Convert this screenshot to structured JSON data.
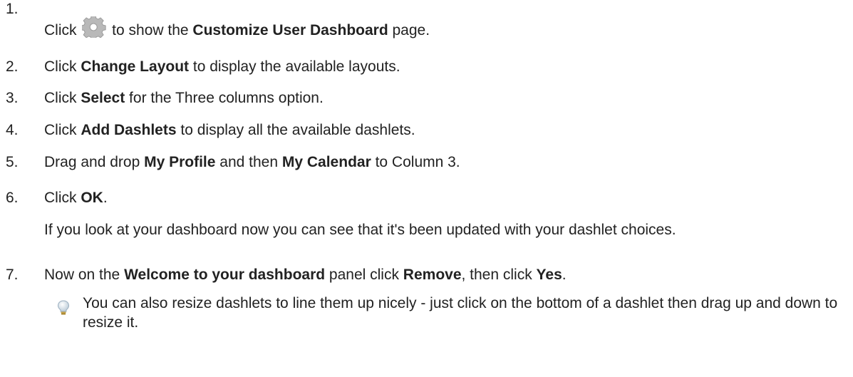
{
  "steps": [
    {
      "num": "1.",
      "pre": "Click ",
      "post": " to show the ",
      "bold": "Customize User Dashboard",
      "end": " page.",
      "icon": "gear-icon"
    },
    {
      "num": "2.",
      "pre": "Click ",
      "bold": "Change Layout",
      "end": " to display the available layouts."
    },
    {
      "num": "3.",
      "pre": "Click ",
      "bold": "Select",
      "end": " for the Three columns option."
    },
    {
      "num": "4.",
      "pre": "Click ",
      "bold": "Add Dashlets",
      "end": " to display all the available dashlets."
    },
    {
      "num": "5.",
      "pre": "Drag and drop ",
      "bold": "My Profile",
      "mid": " and then ",
      "bold2": "My Calendar",
      "end": " to Column 3."
    },
    {
      "num": "6.",
      "pre": "Click ",
      "bold": "OK",
      "end": "."
    },
    {
      "num": "7.",
      "pre": "Now on the ",
      "bold": "Welcome to your dashboard",
      "mid": " panel click ",
      "bold2": "Remove",
      "mid2": ", then click ",
      "bold3": "Yes",
      "end": "."
    }
  ],
  "note_step6": "If you look at your dashboard now you can see that it's been updated with your dashlet choices.",
  "tip": {
    "icon": "lightbulb-icon",
    "text": "You can also resize dashlets to line them up nicely - just click on the bottom of a dashlet then drag up and down to resize it."
  }
}
